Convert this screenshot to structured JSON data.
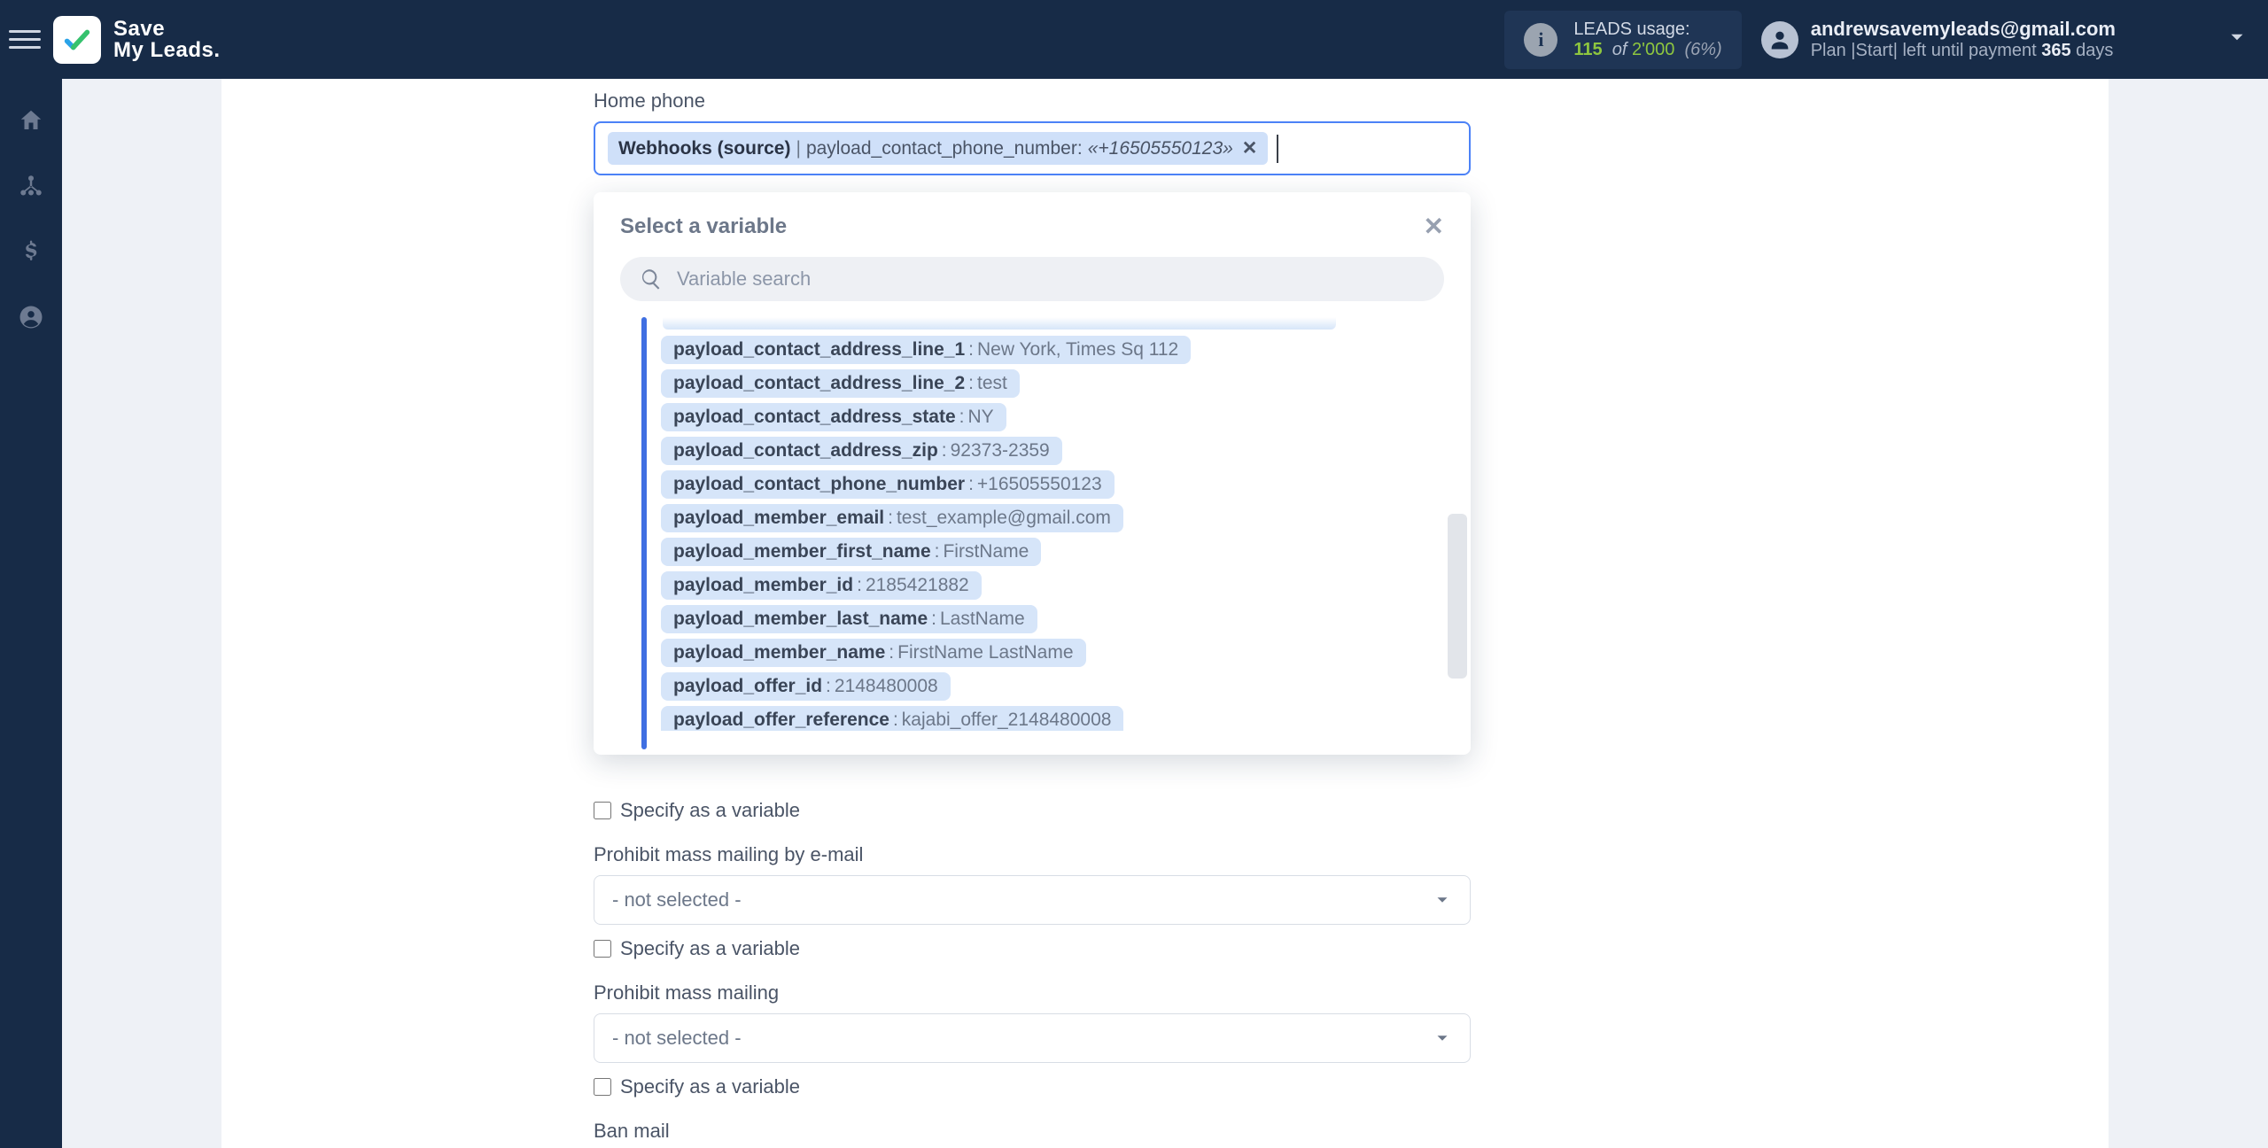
{
  "app_name_line1": "Save",
  "app_name_line2": "My Leads.",
  "leads": {
    "title": "LEADS usage:",
    "current": "115",
    "of": "of",
    "total": "2'000",
    "pct": "(6%)"
  },
  "user": {
    "email": "andrewsavemyleads@gmail.com",
    "plan_prefix": "Plan |Start| left until payment ",
    "plan_days_num": "365",
    "plan_days_word": " days"
  },
  "field": {
    "label": "Home phone",
    "chip_source": "Webhooks (source)",
    "chip_sep": " | ",
    "chip_key": "payload_contact_phone_number: ",
    "chip_val": "«+16505550123»"
  },
  "panel": {
    "title": "Select a variable",
    "search_placeholder": "Variable search"
  },
  "variables": [
    {
      "k": "payload_contact_address_line_1",
      "v": "New York, Times Sq 112"
    },
    {
      "k": "payload_contact_address_line_2",
      "v": "test"
    },
    {
      "k": "payload_contact_address_state",
      "v": "NY"
    },
    {
      "k": "payload_contact_address_zip",
      "v": "92373-2359"
    },
    {
      "k": "payload_contact_phone_number",
      "v": "+16505550123"
    },
    {
      "k": "payload_member_email",
      "v": "test_example@gmail.com"
    },
    {
      "k": "payload_member_first_name",
      "v": "FirstName"
    },
    {
      "k": "payload_member_id",
      "v": "2185421882"
    },
    {
      "k": "payload_member_last_name",
      "v": "LastName"
    },
    {
      "k": "payload_member_name",
      "v": "FirstName LastName"
    },
    {
      "k": "payload_offer_id",
      "v": "2148480008"
    },
    {
      "k": "payload_offer_reference",
      "v": "kajabi_offer_2148480008"
    }
  ],
  "below": {
    "specify": "Specify as a variable",
    "prohibit_email_label": "Prohibit mass mailing by e-mail",
    "not_selected": "- not selected -",
    "prohibit_mass_label": "Prohibit mass mailing",
    "ban_mail_label": "Ban mail"
  }
}
